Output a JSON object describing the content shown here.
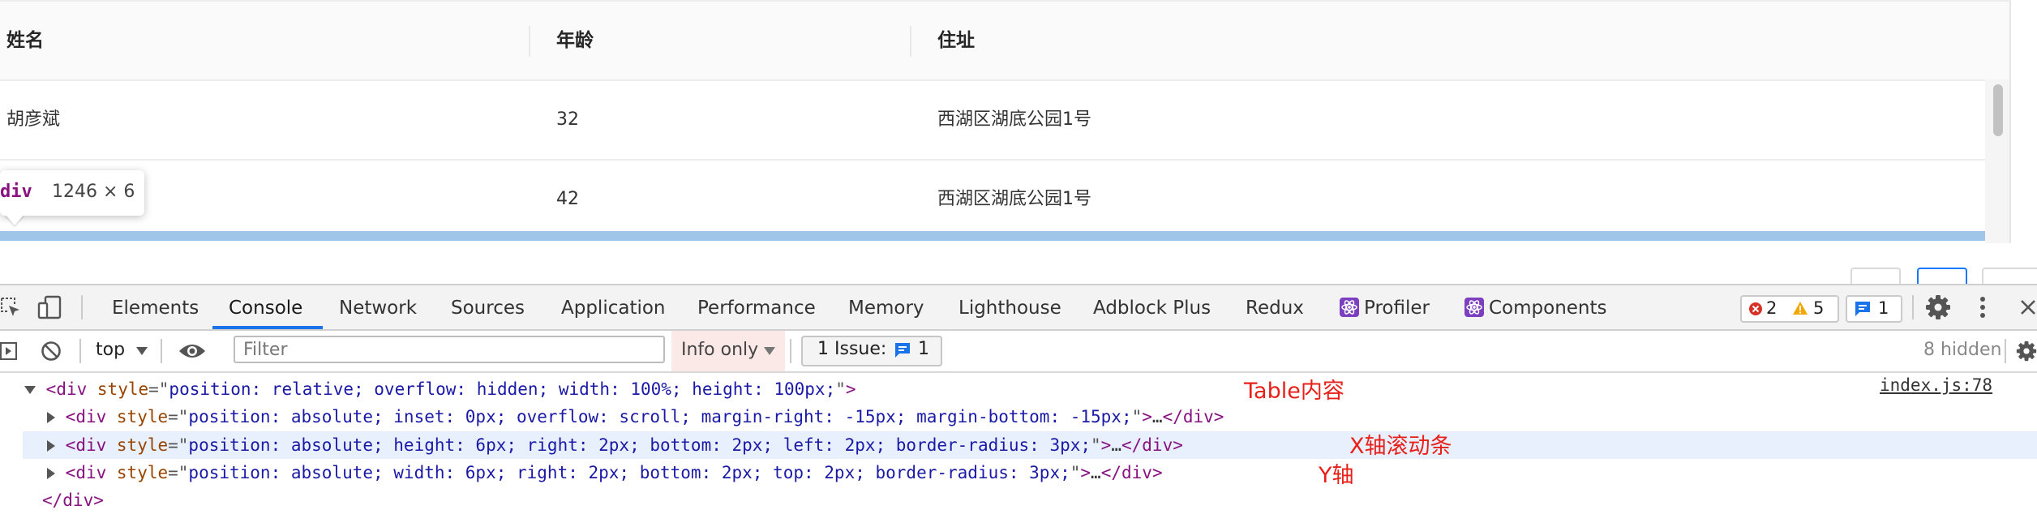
{
  "table": {
    "columns": [
      "姓名",
      "年龄",
      "住址"
    ],
    "rows": [
      {
        "name": "胡彦斌",
        "age": "32",
        "address": "西湖区湖底公园1号"
      },
      {
        "name": "",
        "age": "42",
        "address": "西湖区湖底公园1号"
      }
    ]
  },
  "tooltip": {
    "tag": "div",
    "dimensions": "1246 × 6"
  },
  "devtools": {
    "tabs": [
      "Elements",
      "Console",
      "Network",
      "Sources",
      "Application",
      "Performance",
      "Memory",
      "Lighthouse",
      "Adblock Plus",
      "Redux",
      "Profiler",
      "Components"
    ],
    "active_tab": "Console",
    "counters": {
      "errors": "2",
      "warnings": "5",
      "messages": "1"
    },
    "toolbar": {
      "context": "top",
      "filter_placeholder": "Filter",
      "level": "Info only",
      "issue_label": "1 Issue:",
      "issue_count": "1",
      "hidden": "8 hidden"
    },
    "source_link": "index.js:78",
    "code": {
      "line1": {
        "tag": "div",
        "attr": "style",
        "value": "position: relative; overflow: hidden; width: 100%; height: 100px;",
        "note": "Table内容"
      },
      "line2": {
        "tag": "div",
        "attr": "style",
        "value": "position: absolute; inset: 0px; overflow: scroll; margin-right: -15px; margin-bottom: -15px;",
        "ellipsis": "…"
      },
      "line3": {
        "tag": "div",
        "attr": "style",
        "value": "position: absolute; height: 6px; right: 2px; bottom: 2px; left: 2px; border-radius: 3px;",
        "ellipsis": "…",
        "note": "X轴滚动条"
      },
      "line4": {
        "tag": "div",
        "attr": "style",
        "value": "position: absolute; width: 6px; right: 2px; bottom: 2px; top: 2px; border-radius: 3px;",
        "ellipsis": "…",
        "note": "Y轴"
      },
      "line5": {
        "close": "</div>"
      }
    }
  }
}
